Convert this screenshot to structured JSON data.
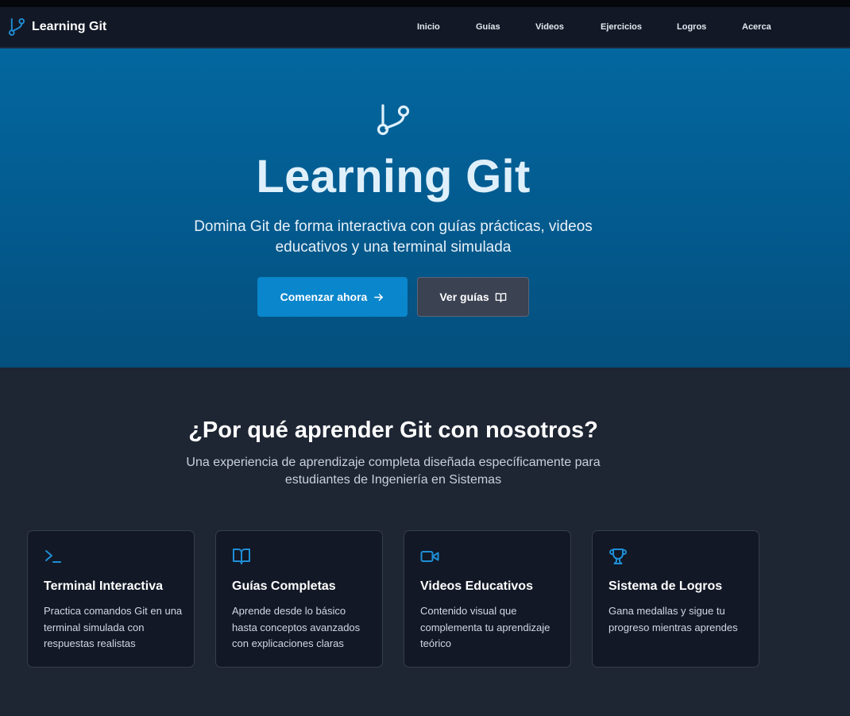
{
  "brand": {
    "name": "Learning Git",
    "icon": "git-branch-icon",
    "accent_color": "#1e8fd6"
  },
  "nav": {
    "items": [
      {
        "label": "Inicio"
      },
      {
        "label": "Guías"
      },
      {
        "label": "Videos"
      },
      {
        "label": "Ejercicios"
      },
      {
        "label": "Logros"
      },
      {
        "label": "Acerca"
      }
    ]
  },
  "hero": {
    "icon": "git-branch-icon",
    "title": "Learning Git",
    "subtitle": "Domina Git de forma interactiva con guías prácticas, videos educativos y una terminal simulada",
    "primary_button": {
      "label": "Comenzar ahora",
      "icon": "arrow-right-icon",
      "color": "#0a86cc"
    },
    "secondary_button": {
      "label": "Ver guías",
      "icon": "book-open-icon",
      "color": "#3b4252"
    },
    "background_color": "#03679f"
  },
  "features": {
    "title": "¿Por qué aprender Git con nosotros?",
    "subtitle": "Una experiencia de aprendizaje completa diseñada específicamente para estudiantes de Ingeniería en Sistemas",
    "cards": [
      {
        "icon": "terminal-icon",
        "title": "Terminal Interactiva",
        "description": "Practica comandos Git en una terminal simulada con respuestas realistas"
      },
      {
        "icon": "book-open-icon",
        "title": "Guías Completas",
        "description": "Aprende desde lo básico hasta conceptos avanzados con explicaciones claras"
      },
      {
        "icon": "video-icon",
        "title": "Videos Educativos",
        "description": "Contenido visual que complementa tu aprendizaje teórico"
      },
      {
        "icon": "trophy-icon",
        "title": "Sistema de Logros",
        "description": "Gana medallas y sigue tu progreso mientras aprendes"
      }
    ]
  },
  "colors": {
    "page_background": "#1e2533",
    "navbar_background": "#121826",
    "card_background": "#121826",
    "icon_accent": "#1e8fd6"
  }
}
